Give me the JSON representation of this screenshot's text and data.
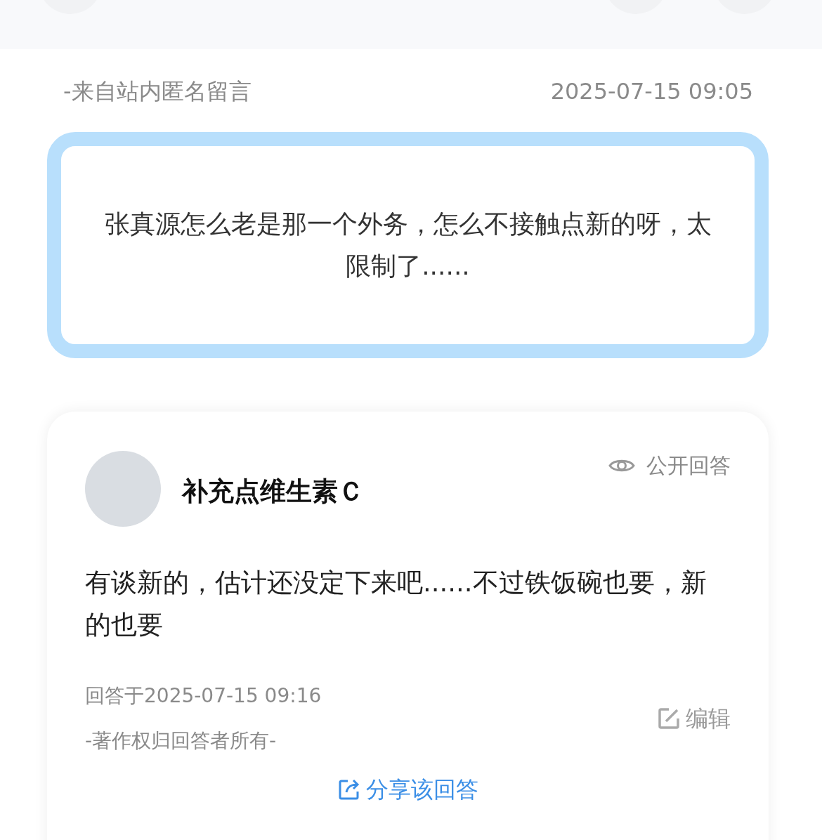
{
  "question": {
    "source": "-来自站内匿名留言",
    "time": "2025-07-15 09:05",
    "text": "张真源怎么老是那一个外务，怎么不接触点新的呀，太限制了......"
  },
  "answer": {
    "author": "补充点维生素Ｃ",
    "visibility": "公开回答",
    "text": "有谈新的，估计还没定下来吧......不过铁饭碗也要，新的也要",
    "answered_at": "回答于2025-07-15 09:16",
    "copyright": "-著作权归回答者所有-",
    "edit": "编辑",
    "share": "分享该回答"
  }
}
